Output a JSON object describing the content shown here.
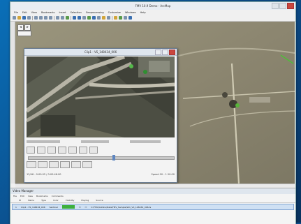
{
  "window": {
    "title": "FMV 10.9 Demo - ArcMap",
    "menu": [
      "File",
      "Edit",
      "View",
      "Bookmarks",
      "Insert",
      "Selection",
      "Geoprocessing",
      "Customize",
      "Windows",
      "Help"
    ]
  },
  "toolbar": {
    "icons": [
      "new-icon",
      "open-icon",
      "save-icon",
      "print-icon",
      "cut-icon",
      "copy-icon",
      "paste-icon",
      "delete-icon",
      "undo-icon",
      "redo-icon",
      "add-data-icon",
      "zoom-in-icon",
      "zoom-out-icon",
      "pan-icon",
      "full-extent-icon",
      "identify-icon",
      "find-icon",
      "measure-icon",
      "hyperlink-icon"
    ]
  },
  "video_player": {
    "title": "Clip1 - VS_148434_006",
    "status": [
      "Frame 0 / 0000:00",
      "Frame 00-00",
      "Recorded 00:00"
    ],
    "footer_left": "12/46 - 0:00:05 / 0:00:46.00",
    "footer_right": "Speed 00 - 1 00:00"
  },
  "video_manager": {
    "title": "Video Manager",
    "menu": [
      "File",
      "Edit",
      "View",
      "Bookmarks",
      "Commands"
    ],
    "columns": [
      "ID",
      "Name",
      "Type",
      "Color",
      "Visibility",
      "Playing",
      "Source"
    ],
    "row": {
      "id": "1",
      "name": "Clip1 - VS_148434_006",
      "type": "Sentinel",
      "source": "C:\\FMV\\Addins\\Data\\FMV_Sample\\S01_VS_148434_006.ts"
    },
    "row_color": "#3db03d"
  }
}
